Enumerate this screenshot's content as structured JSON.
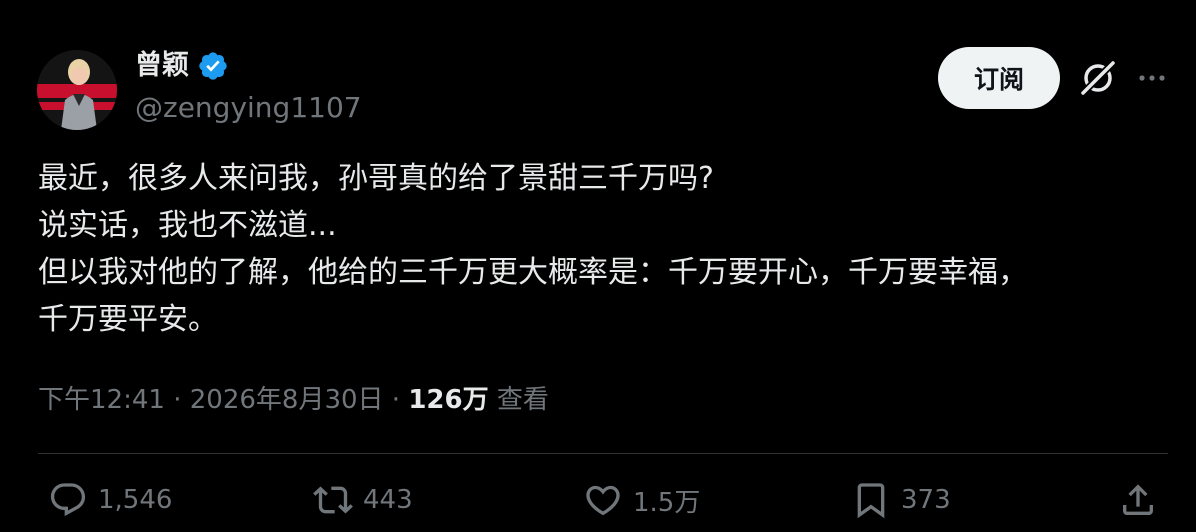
{
  "author": {
    "display_name": "曾颖",
    "handle": "@zengying1107",
    "verified_icon": "verified-badge-icon",
    "accent_color": "#1d9bf0"
  },
  "header_actions": {
    "subscribe_label": "订阅",
    "grok_icon": "grok-icon",
    "more_icon": "more-dots-icon"
  },
  "tweet": {
    "lines": [
      "最近，很多人来问我，孙哥真的给了景甜三千万吗?",
      "说实话，我也不滋道...",
      "但以我对他的了解，他给的三千万更大概率是：千万要开心，千万要幸福，",
      "千万要平安。"
    ]
  },
  "meta": {
    "time": "下午12:41",
    "separator": "·",
    "date": "2026年8月30日",
    "views_count": "126万",
    "views_label": "查看"
  },
  "actions": {
    "replies": "1,546",
    "retweets": "443",
    "likes": "1.5万",
    "bookmarks": "373"
  }
}
